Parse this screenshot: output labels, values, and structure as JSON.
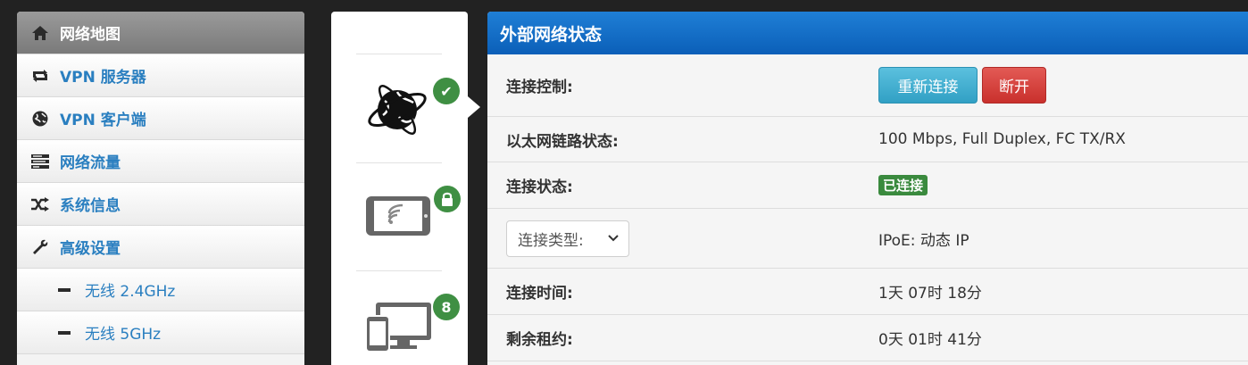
{
  "sidebar": {
    "items": [
      {
        "label": "网络地图",
        "icon": "home-icon",
        "active": true
      },
      {
        "label": "VPN 服务器",
        "icon": "retweet-icon"
      },
      {
        "label": "VPN 客户端",
        "icon": "globe-icon"
      },
      {
        "label": "网络流量",
        "icon": "tasks-icon"
      },
      {
        "label": "系统信息",
        "icon": "random-icon"
      },
      {
        "label": "高级设置",
        "icon": "wrench-icon"
      },
      {
        "label": "无线 2.4GHz",
        "icon": "minus-icon"
      },
      {
        "label": "无线 5GHz",
        "icon": "minus-icon"
      }
    ]
  },
  "midcol": {
    "internet_badge": "✔",
    "wireless_badge": "lock",
    "clients_count": "8"
  },
  "panel": {
    "title": "外部网络状态",
    "rows": {
      "control_label": "连接控制:",
      "reconnect_btn": "重新连接",
      "disconnect_btn": "断开",
      "ethernet_label": "以太网链路状态:",
      "ethernet_value": "100 Mbps, Full Duplex, FC TX/RX",
      "conn_status_label": "连接状态:",
      "conn_status_value": "已连接",
      "conn_type_select": "连接类型:",
      "conn_type_value": "IPoE: 动态 IP",
      "conn_time_label": "连接时间:",
      "conn_time_value": "1天 07时 18分",
      "lease_label": "剩余租约:",
      "lease_value": "0天 01时 41分"
    }
  },
  "colors": {
    "accent_blue": "#0b5fb8",
    "link_blue": "#2a7fc0",
    "success_green": "#3a8a3e",
    "danger_red": "#c9302c"
  }
}
